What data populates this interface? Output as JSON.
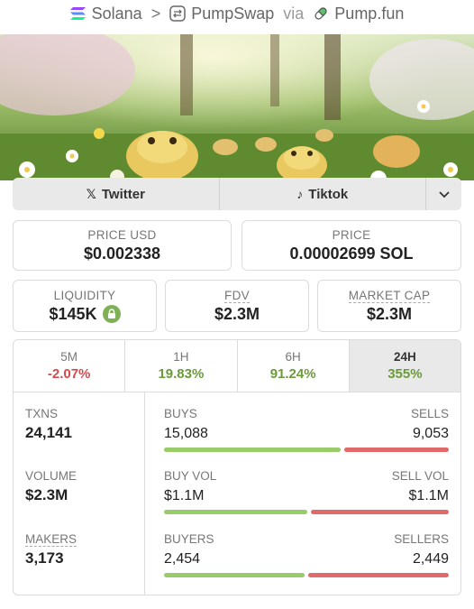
{
  "breadcrumb": {
    "chain": "Solana",
    "separator": ">",
    "dex": "PumpSwap",
    "via": "via",
    "launchpad": "Pump.fun"
  },
  "socials": {
    "twitter": "Twitter",
    "tiktok": "Tiktok"
  },
  "stats": {
    "price_usd_label": "PRICE USD",
    "price_usd": "$0.002338",
    "price_label": "PRICE",
    "price": "0.00002699 SOL",
    "liquidity_label": "LIQUIDITY",
    "liquidity": "$145K",
    "fdv_label": "FDV",
    "fdv": "$2.3M",
    "mcap_label": "MARKET CAP",
    "mcap": "$2.3M"
  },
  "timeframes": [
    {
      "label": "5M",
      "change": "-2.07%",
      "color": "#d64a4a",
      "active": false
    },
    {
      "label": "1H",
      "change": "19.83%",
      "color": "#6b9a3a",
      "active": false
    },
    {
      "label": "6H",
      "change": "91.24%",
      "color": "#6b9a3a",
      "active": false
    },
    {
      "label": "24H",
      "change": "355%",
      "color": "#6b9a3a",
      "active": true
    }
  ],
  "metrics": {
    "txns_label": "TXNS",
    "txns": "24,141",
    "volume_label": "VOLUME",
    "volume": "$2.3M",
    "makers_label": "MAKERS",
    "makers": "3,173"
  },
  "splits": {
    "buys_label": "BUYS",
    "buys": "15,088",
    "sells_label": "SELLS",
    "sells": "9,053",
    "buy_vol_label": "BUY VOL",
    "buy_vol": "$1.1M",
    "sell_vol_label": "SELL VOL",
    "sell_vol": "$1.1M",
    "buyers_label": "BUYERS",
    "buyers": "2,454",
    "sellers_label": "SELLERS",
    "sellers": "2,449"
  },
  "colors": {
    "buy": "#9acb6a",
    "sell": "#e06a6a",
    "positive": "#6b9a3a",
    "negative": "#d64a4a"
  }
}
